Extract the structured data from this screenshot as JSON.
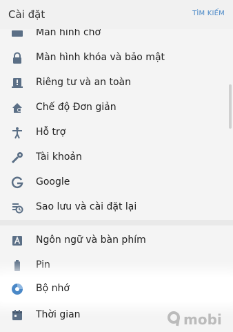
{
  "header": {
    "title": "Cài đặt",
    "search": "TÌM KIẾM"
  },
  "items": [
    {
      "label": "Màn hình chờ",
      "icon": "home-screen-icon"
    },
    {
      "label": "Màn hình khóa và bảo mật",
      "icon": "lock-icon"
    },
    {
      "label": "Riêng tư và an toàn",
      "icon": "privacy-icon"
    },
    {
      "label": "Chế độ Đơn giản",
      "icon": "easy-mode-home-icon"
    },
    {
      "label": "Hỗ trợ",
      "icon": "accessibility-icon"
    },
    {
      "label": "Tài khoản",
      "icon": "key-icon"
    },
    {
      "label": "Google",
      "icon": "google-icon"
    },
    {
      "label": "Sao lưu và cài đặt lại",
      "icon": "backup-icon"
    },
    {
      "label": "Ngôn ngữ và bàn phím",
      "icon": "language-icon"
    },
    {
      "label": "Pin",
      "icon": "battery-icon"
    },
    {
      "label": "Bộ nhớ",
      "icon": "storage-icon"
    },
    {
      "label": "Thời gian",
      "icon": "calendar-icon"
    }
  ],
  "watermark": "mobi",
  "colors": {
    "accent": "#4a88c7",
    "icon": "#5b6f86",
    "text": "#222222"
  }
}
